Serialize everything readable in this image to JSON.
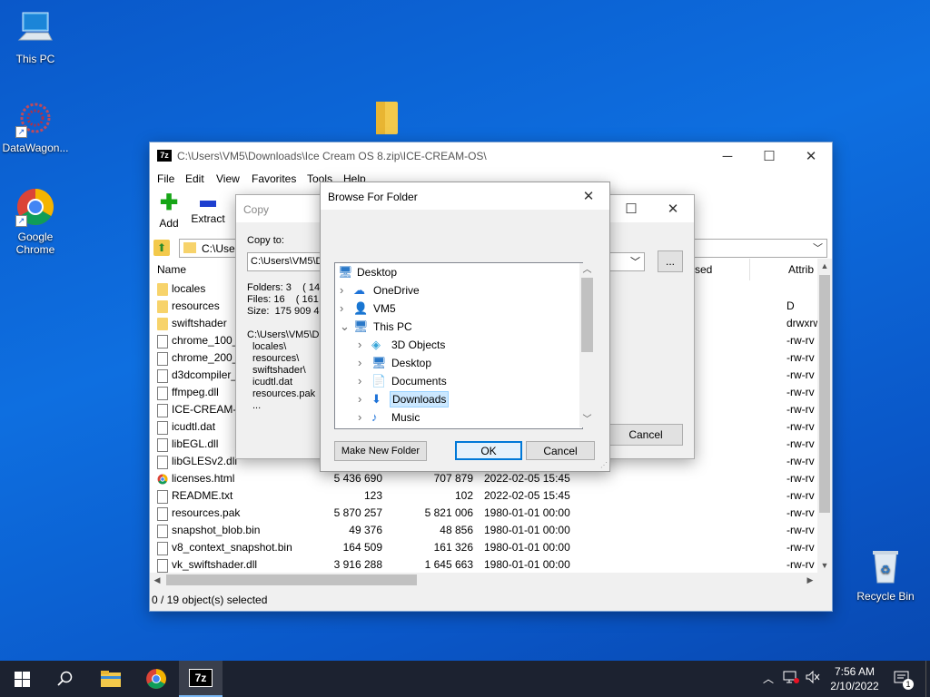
{
  "desktop": {
    "icons": [
      {
        "label": "This PC"
      },
      {
        "label": "DataWagon..."
      },
      {
        "label": "Google Chrome"
      },
      {
        "label": "Recycle Bin"
      }
    ]
  },
  "main_window": {
    "title": "C:\\Users\\VM5\\Downloads\\Ice Cream OS 8.zip\\ICE-CREAM-OS\\",
    "app_badge": "7z",
    "menu": [
      "File",
      "Edit",
      "View",
      "Favorites",
      "Tools",
      "Help"
    ],
    "toolbar": {
      "add": "Add",
      "extract": "Extract"
    },
    "address": "C:\\User",
    "columns": {
      "name": "Name",
      "used": "sed",
      "attrib": "Attrib"
    },
    "rows": [
      {
        "name": "locales",
        "size": "",
        "packed": "",
        "modified": "",
        "attrib": ""
      },
      {
        "name": "resources",
        "size": "",
        "packed": "",
        "modified": "",
        "attrib": "D drwxrw"
      },
      {
        "name": "swiftshader",
        "size": "",
        "packed": "",
        "modified": "",
        "attrib": ""
      },
      {
        "name": "chrome_100_p",
        "size": "",
        "packed": "",
        "modified": "",
        "attrib": "-rw-rv"
      },
      {
        "name": "chrome_200_p",
        "size": "",
        "packed": "",
        "modified": "",
        "attrib": "-rw-rv"
      },
      {
        "name": "d3dcompiler_",
        "size": "",
        "packed": "",
        "modified": "",
        "attrib": "-rw-rv"
      },
      {
        "name": "ffmpeg.dll",
        "size": "",
        "packed": "",
        "modified": "",
        "attrib": "-rw-rv"
      },
      {
        "name": "ICE-CREAM-C",
        "size": "",
        "packed": "",
        "modified": "",
        "attrib": "-rw-rv"
      },
      {
        "name": "icudtl.dat",
        "size": "",
        "packed": "",
        "modified": "",
        "attrib": "-rw-rv"
      },
      {
        "name": "libEGL.dll",
        "size": "",
        "packed": "",
        "modified": "",
        "attrib": "-rw-rv"
      },
      {
        "name": "libGLESv2.dll",
        "size": "",
        "packed": "",
        "modified": "",
        "attrib": "-rw-rv"
      },
      {
        "name": "licenses.html",
        "size": "5 436 690",
        "packed": "707 879",
        "modified": "2022-02-05 15:45",
        "attrib": "-rw-rv"
      },
      {
        "name": "README.txt",
        "size": "123",
        "packed": "102",
        "modified": "2022-02-05 15:45",
        "attrib": "-rw-rv"
      },
      {
        "name": "resources.pak",
        "size": "5 870 257",
        "packed": "5 821 006",
        "modified": "1980-01-01 00:00",
        "attrib": "-rw-rv"
      },
      {
        "name": "snapshot_blob.bin",
        "size": "49 376",
        "packed": "48 856",
        "modified": "1980-01-01 00:00",
        "attrib": "-rw-rv"
      },
      {
        "name": "v8_context_snapshot.bin",
        "size": "164 509",
        "packed": "161 326",
        "modified": "1980-01-01 00:00",
        "attrib": "-rw-rv"
      },
      {
        "name": "vk_swiftshader.dll",
        "size": "3 916 288",
        "packed": "1 645 663",
        "modified": "1980-01-01 00:00",
        "attrib": "-rw-rv"
      }
    ],
    "status": "0 / 19 object(s) selected"
  },
  "copy_dialog": {
    "title": "Copy",
    "copy_to_label": "Copy to:",
    "path": "C:\\Users\\VM5\\D",
    "folders": "Folders: 3    ( 14",
    "files": "Files: 16    ( 161 5",
    "size": "Size:  175 909 49",
    "source_path": "C:\\Users\\VM5\\D",
    "items": [
      "locales\\",
      "resources\\",
      "swiftshader\\",
      "icudtl.dat",
      "resources.pak",
      "..."
    ],
    "browse_btn": "...",
    "cancel": "Cancel"
  },
  "browse_dialog": {
    "title": "Browse For Folder",
    "tree": [
      {
        "label": "Desktop",
        "level": 0
      },
      {
        "label": "OneDrive",
        "level": 1
      },
      {
        "label": "VM5",
        "level": 1
      },
      {
        "label": "This PC",
        "level": 1
      },
      {
        "label": "3D Objects",
        "level": 2
      },
      {
        "label": "Desktop",
        "level": 2
      },
      {
        "label": "Documents",
        "level": 2
      },
      {
        "label": "Downloads",
        "level": 2
      },
      {
        "label": "Music",
        "level": 2
      }
    ],
    "selected_index": 7,
    "make_new_folder": "Make New Folder",
    "ok": "OK",
    "cancel": "Cancel"
  },
  "taskbar": {
    "time": "7:56 AM",
    "date": "2/10/2022",
    "notification_count": "1",
    "app_7z": "7z"
  }
}
